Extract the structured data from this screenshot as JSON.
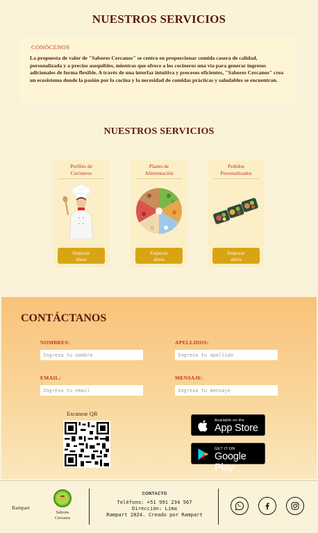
{
  "header": {
    "title": "NUESTROS SERVICIOS"
  },
  "about": {
    "label": "CONÓCENOS",
    "text": "La propuesta de valor de \"Sabores Cercanos\" se centra en proporcionar comida casera de calidad, personalizada y a precios asequibles, mientras que ofrece a los cocineros una vía para generar ingresos adicionales de forma flexible. A través de una interfaz intuitiva y procesos eficientes, \"Sabores Cercanos\" crea un ecosistema donde la pasión por la cocina y la necesidad de comidas prácticas y saludables se encuentran."
  },
  "services": {
    "title": "NUESTROS SERVICIOS",
    "cards": [
      {
        "title_line1": "Perfiles de",
        "title_line2": "Cocineros",
        "button_line1": "Empezar",
        "button_line2": "ahora",
        "image": "chef-illustration"
      },
      {
        "title_line1": "Planes de",
        "title_line2": "Alimentación",
        "button_line1": "Empezar",
        "button_line2": "ahora",
        "image": "food-wheel-illustration"
      },
      {
        "title_line1": "Pedidos",
        "title_line2": "Personalizados",
        "button_line1": "Empezar",
        "button_line2": "ahora",
        "image": "meal-containers-illustration"
      }
    ]
  },
  "contact": {
    "title": "CONTÁCTANOS",
    "fields": {
      "names": {
        "label": "NOMBRES:",
        "placeholder": "Ingresa tu nombre",
        "value": ""
      },
      "surnames": {
        "label": "APELLIDOS:",
        "placeholder": "Ingresa tu apellido",
        "value": ""
      },
      "email": {
        "label": "EMAIL:",
        "placeholder": "Ingresa tu email",
        "value": ""
      },
      "message": {
        "label": "MENSAJE:",
        "placeholder": "Ingresa tu mensaje",
        "value": ""
      }
    },
    "qr_label": "Escanear QR",
    "app_store": {
      "small": "Available on the",
      "big": "App Store",
      "icon": "apple-icon"
    },
    "google_play": {
      "small": "GET IT ON",
      "big": "Google Play",
      "icon": "google-play-icon"
    }
  },
  "footer": {
    "brand": "Rampart",
    "logo_label_line1": "Sabores",
    "logo_label_line2": "Cercanos",
    "contact_title": "CONTACTO",
    "phone": "Teléfono: +51 991 234 567",
    "address": "Dirección: Lima",
    "credits": "Rampart 2024. Creado por Rampart",
    "social": [
      "whatsapp-icon",
      "facebook-icon",
      "instagram-icon"
    ]
  },
  "colors": {
    "accent": "#c0321f",
    "button": "#d9a414",
    "background": "#faf3d9",
    "title": "#5a1a0c"
  }
}
